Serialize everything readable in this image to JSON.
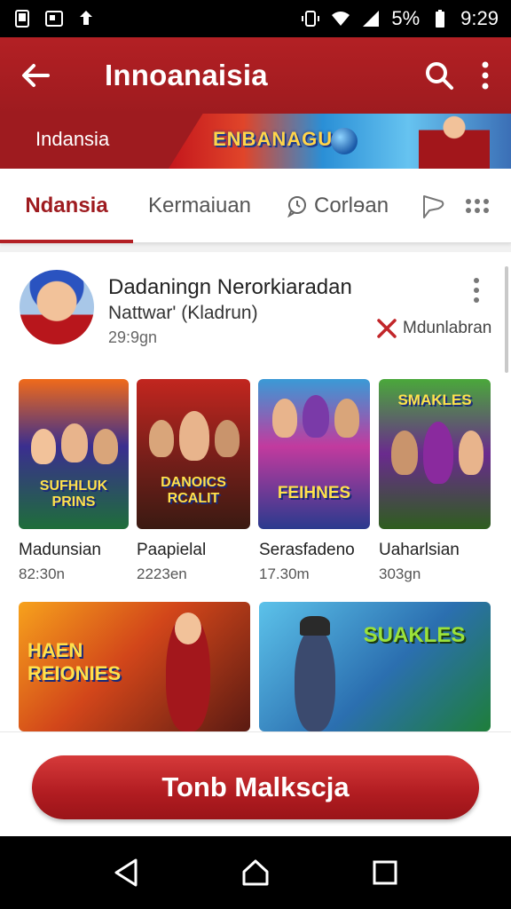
{
  "status_bar": {
    "battery": "5%",
    "time": "9:29",
    "left_icons": [
      "tablet-icon",
      "media-icon",
      "recycle-icon"
    ],
    "right_icons": [
      "vibrate-icon",
      "wifi-icon",
      "signal-icon",
      "battery-icon"
    ]
  },
  "app_bar": {
    "title": "Innoanaisia",
    "back_icon": "arrow-left-icon",
    "search_icon": "search-icon",
    "menu_icon": "more-vertical-icon"
  },
  "banner": {
    "label": "Indansia",
    "art_text": "ENBANAGU"
  },
  "tabs": [
    {
      "label": "Ndansia",
      "active": true
    },
    {
      "label": "Kermaiuan",
      "active": false
    },
    {
      "label": "Corlɘan",
      "active": false
    }
  ],
  "profile": {
    "title": "Dadaningn Nerorkiaradan",
    "subtitle": "Nattwar' (Kladrun)",
    "time": "29:9gn",
    "action_label": "Mdunlabran"
  },
  "thumbnails": [
    {
      "title": "SUFHLUK PRINS",
      "caption": "Madunsian",
      "time": "82:30n"
    },
    {
      "title": "DANOICS RCALIT",
      "caption": "Paapielal",
      "time": "2223en"
    },
    {
      "title": "FEIHNES",
      "caption": "Serasfadeno",
      "time": "17.30m"
    },
    {
      "title": "SMAKLES",
      "caption": "Uaharlsian",
      "time": "303gn"
    },
    {
      "title": "HAEN REIONIES",
      "caption": "",
      "time": ""
    },
    {
      "title": "SUAKLES",
      "caption": "",
      "time": ""
    }
  ],
  "cta": {
    "label": "Tonb Malkscja"
  },
  "colors": {
    "brand_red": "#b32024",
    "dark_red": "#9e1b1f",
    "background": "#f1f1f1"
  }
}
